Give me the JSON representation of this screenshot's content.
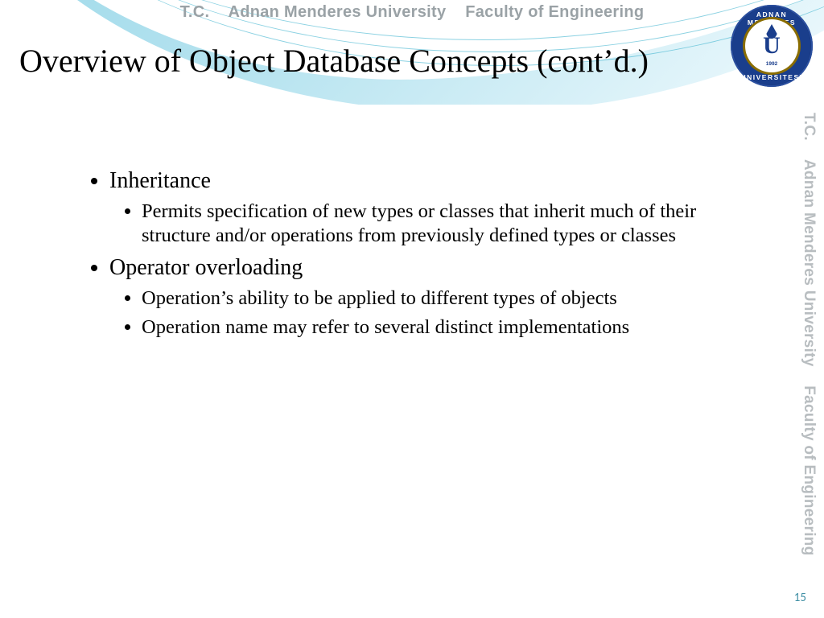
{
  "header": {
    "tc": "T.C.",
    "university": "Adnan Menderes University",
    "faculty": "Faculty of Engineering"
  },
  "logo": {
    "ring_top": "ADNAN MENDERES",
    "ring_bottom": "UNIVERSITESI",
    "letter": "U",
    "year": "1992"
  },
  "side": {
    "tc": "T.C.",
    "university": "Adnan Menderes University",
    "faculty": "Faculty of Engineering"
  },
  "title": "Overview of Object Database Concepts (cont’d.)",
  "bullets": [
    {
      "text": "Inheritance",
      "sub": [
        "Permits specification of new types or classes that inherit much of their structure and/or operations from previously defined types or classes"
      ]
    },
    {
      "text": "Operator overloading",
      "sub": [
        "Operation’s ability to be applied to different types of objects",
        "Operation name may refer to several distinct implementations"
      ]
    }
  ],
  "page_number": "15"
}
